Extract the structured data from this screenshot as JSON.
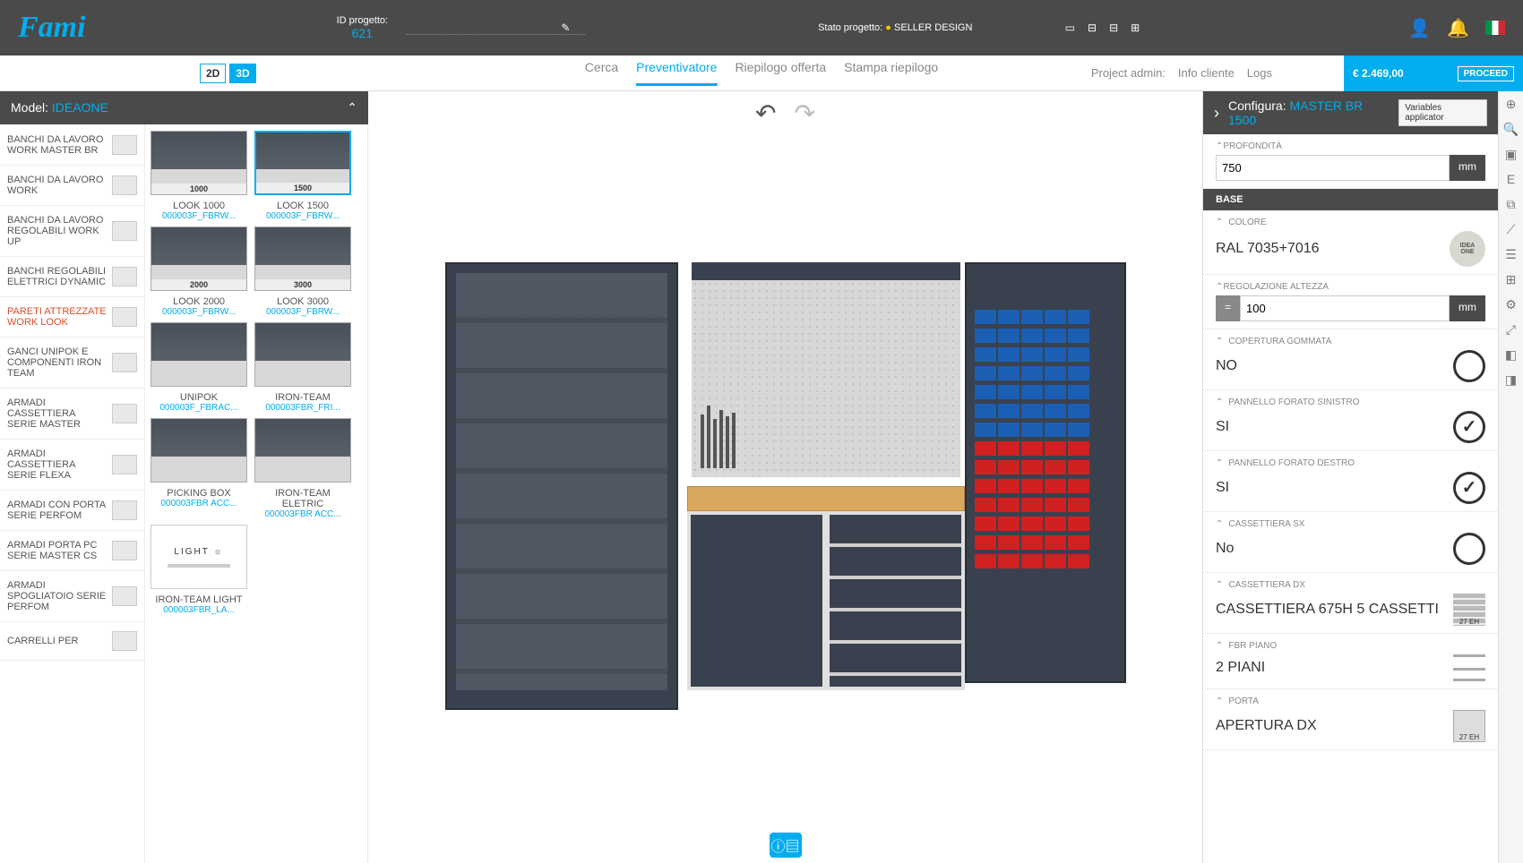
{
  "top": {
    "logo": "Fami",
    "proj_id_label": "ID progetto:",
    "proj_id": "621",
    "status_label": "Stato progetto:",
    "status_value": "SELLER DESIGN"
  },
  "subbar": {
    "view2d": "2D",
    "view3d": "3D",
    "tabs": [
      "Cerca",
      "Preventivatore",
      "Riepilogo offerta",
      "Stampa riepilogo"
    ],
    "active_tab": 1,
    "admin_label": "Project admin:",
    "admin_links": [
      "Info cliente",
      "Logs"
    ],
    "price": "€ 2.469,00",
    "proceed": "PROCEED"
  },
  "model": {
    "label": "Model:",
    "name": "IDEAONE"
  },
  "categories": [
    "BANCHI DA LAVORO WORK MASTER BR",
    "BANCHI DA LAVORO WORK",
    "BANCHI DA LAVORO REGOLABILI WORK UP",
    "BANCHI REGOLABILI ELETTRICI DYNAMIC",
    "PARETI ATTREZZATE WORK LOOK",
    "GANCI UNIPOK E COMPONENTI IRON TEAM",
    "ARMADI CASSETTIERA SERIE MASTER",
    "ARMADI CASSETTIERA SERIE FLEXA",
    "ARMADI CON PORTA SERIE PERFOM",
    "ARMADI PORTA PC SERIE MASTER CS",
    "ARMADI SPOGLIATOIO SERIE PERFOM",
    "CARRELLI PER"
  ],
  "cat_active": 4,
  "products": [
    {
      "name": "LOOK 1000",
      "code": "000003F_FBRW...",
      "w": "1000"
    },
    {
      "name": "LOOK 1500",
      "code": "000003F_FBRW...",
      "w": "1500",
      "sel": true
    },
    {
      "name": "LOOK 2000",
      "code": "000003F_FBRW...",
      "w": "2000"
    },
    {
      "name": "LOOK 3000",
      "code": "000003F_FBRW...",
      "w": "3000"
    },
    {
      "name": "UNIPOK",
      "code": "000003F_FBRAC..."
    },
    {
      "name": "IRON-TEAM",
      "code": "000003FBR_FRI..."
    },
    {
      "name": "PICKING BOX",
      "code": "000003FBR ACC..."
    },
    {
      "name": "IRON-TEAM ELETRIC",
      "code": "000003FBR ACC..."
    },
    {
      "name": "IRON-TEAM LIGHT",
      "code": "000003FBR_LA...",
      "light": true
    }
  ],
  "cfg": {
    "label": "Configura:",
    "name": "MASTER BR 1500",
    "varbtn": "Variables applicator",
    "profondita_label": "PROFONDITÀ",
    "profondita": "750",
    "base_section": "BASE",
    "colore_label": "COLORE",
    "colore": "RAL 7035+7016",
    "reg_label": "REGOLAZIONE ALTEZZA",
    "reg": "100",
    "cop_label": "COPERTURA GOMMATA",
    "cop": "NO",
    "psx_label": "PANNELLO FORATO SINISTRO",
    "psx": "SI",
    "pdx_label": "PANNELLO FORATO DESTRO",
    "pdx": "SI",
    "csx_label": "CASSETTIERA SX",
    "csx": "No",
    "cdx_label": "CASSETTIERA DX",
    "cdx": "CASSETTIERA 675H 5 CASSETTI",
    "cdx_badge": "27 EH",
    "fbr_label": "FBR PIANO",
    "fbr": "2 PIANI",
    "porta_label": "PORTA",
    "porta": "APERTURA DX",
    "porta_badge": "27 EH",
    "unit": "mm"
  },
  "info_icon": "ⓘ▤",
  "light_label": "LIGHT"
}
